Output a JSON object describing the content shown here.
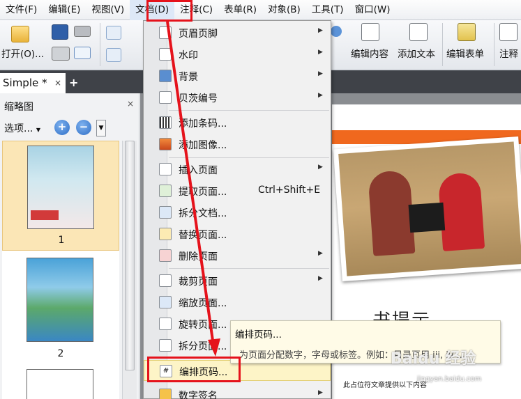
{
  "menubar": {
    "items": [
      "文件(F)",
      "编辑(E)",
      "视图(V)",
      "文档(D)",
      "注释(C)",
      "表单(R)",
      "对象(B)",
      "工具(T)",
      "窗口(W)"
    ]
  },
  "toolbar": {
    "open_label": "打开(O)...",
    "edit_content_label": "编辑内容",
    "add_text_label": "添加文本",
    "edit_form_label": "编辑表单",
    "annotate_label": "注释"
  },
  "tabs": {
    "active_label": "Simple *",
    "close": "×",
    "add": "+"
  },
  "thumb_panel": {
    "title": "缩略图",
    "close": "×",
    "options_label": "选项...",
    "zoom_in": "+",
    "zoom_out": "−",
    "pages": [
      "1",
      "2"
    ]
  },
  "document_menu": {
    "items": [
      {
        "label": "页眉页脚",
        "shortcut": "",
        "submenu": true
      },
      {
        "label": "水印",
        "shortcut": "",
        "submenu": true
      },
      {
        "label": "背景",
        "shortcut": "",
        "submenu": true
      },
      {
        "label": "贝茨编号",
        "shortcut": "",
        "submenu": true
      },
      {
        "label": "添加条码...",
        "shortcut": "",
        "submenu": false
      },
      {
        "label": "添加图像...",
        "shortcut": "",
        "submenu": false
      },
      {
        "label": "插入页面",
        "shortcut": "",
        "submenu": true
      },
      {
        "label": "提取页面...",
        "shortcut": "Ctrl+Shift+E",
        "submenu": false
      },
      {
        "label": "拆分文档...",
        "shortcut": "",
        "submenu": false
      },
      {
        "label": "替换页面...",
        "shortcut": "",
        "submenu": false
      },
      {
        "label": "删除页面",
        "shortcut": "",
        "submenu": true
      },
      {
        "label": "裁剪页面",
        "shortcut": "",
        "submenu": true
      },
      {
        "label": "缩放页面...",
        "shortcut": "",
        "submenu": false
      },
      {
        "label": "旋转页面...",
        "shortcut": "",
        "submenu": false
      },
      {
        "label": "拆分页面...",
        "shortcut": "",
        "submenu": false
      },
      {
        "label": "编排页码...",
        "shortcut": "",
        "submenu": false
      },
      {
        "label": "数字签名",
        "shortcut": "",
        "submenu": true
      }
    ]
  },
  "tooltip": {
    "title": "编排页码...",
    "description": "为页面分配数字，字母或标签。例如：目录页用 iii, iv ..."
  },
  "document": {
    "big_text": "书提示",
    "footer_text": "此占位符文章提供以下内容"
  },
  "watermark": {
    "brand": "Baidu 经验",
    "url": "jingyan.baidu.com"
  },
  "colors": {
    "annotation_red": "#e5121b",
    "highlight": "#fdf4c7",
    "orange_band": "#f0681e"
  }
}
